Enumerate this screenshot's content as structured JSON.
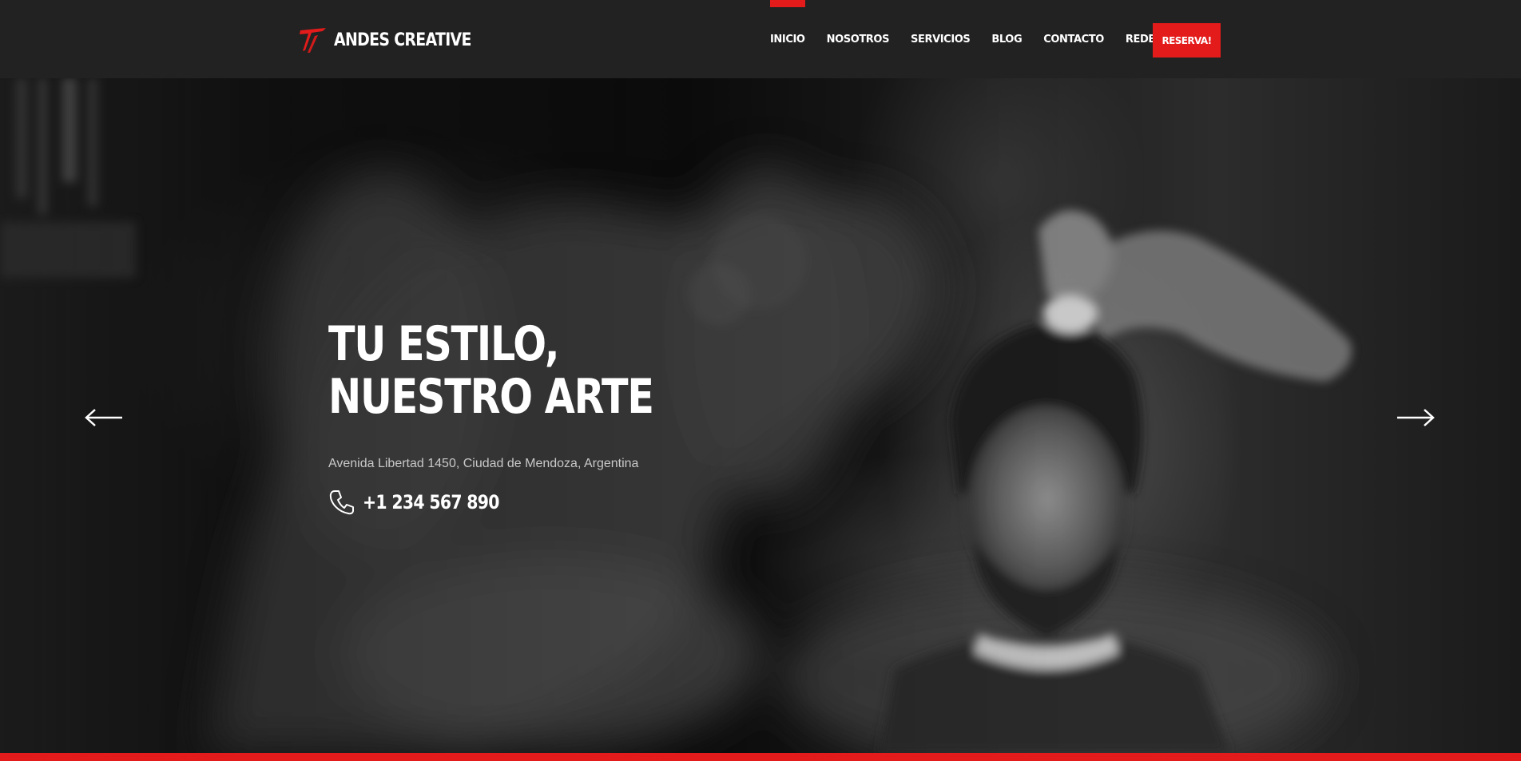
{
  "brand": {
    "name": "ANDES CREATIVE",
    "accent_color": "#e41b1b"
  },
  "nav": {
    "items": [
      {
        "label": "INICIO",
        "active": true
      },
      {
        "label": "NOSOTROS",
        "active": false
      },
      {
        "label": "SERVICIOS",
        "active": false
      },
      {
        "label": "BLOG",
        "active": false
      },
      {
        "label": "CONTACTO",
        "active": false
      },
      {
        "label": "REDES",
        "active": false
      }
    ],
    "cta_label": "RESERVA!"
  },
  "hero": {
    "title_line1": "TU ESTILO,",
    "title_line2": "NUESTRO ARTE",
    "address": "Avenida Libertad 1450, Ciudad de Mendoza, Argentina",
    "phone": "+1 234 567 890",
    "phone_icon": "phone-icon",
    "prev_icon": "arrow-left-icon",
    "next_icon": "arrow-right-icon"
  }
}
